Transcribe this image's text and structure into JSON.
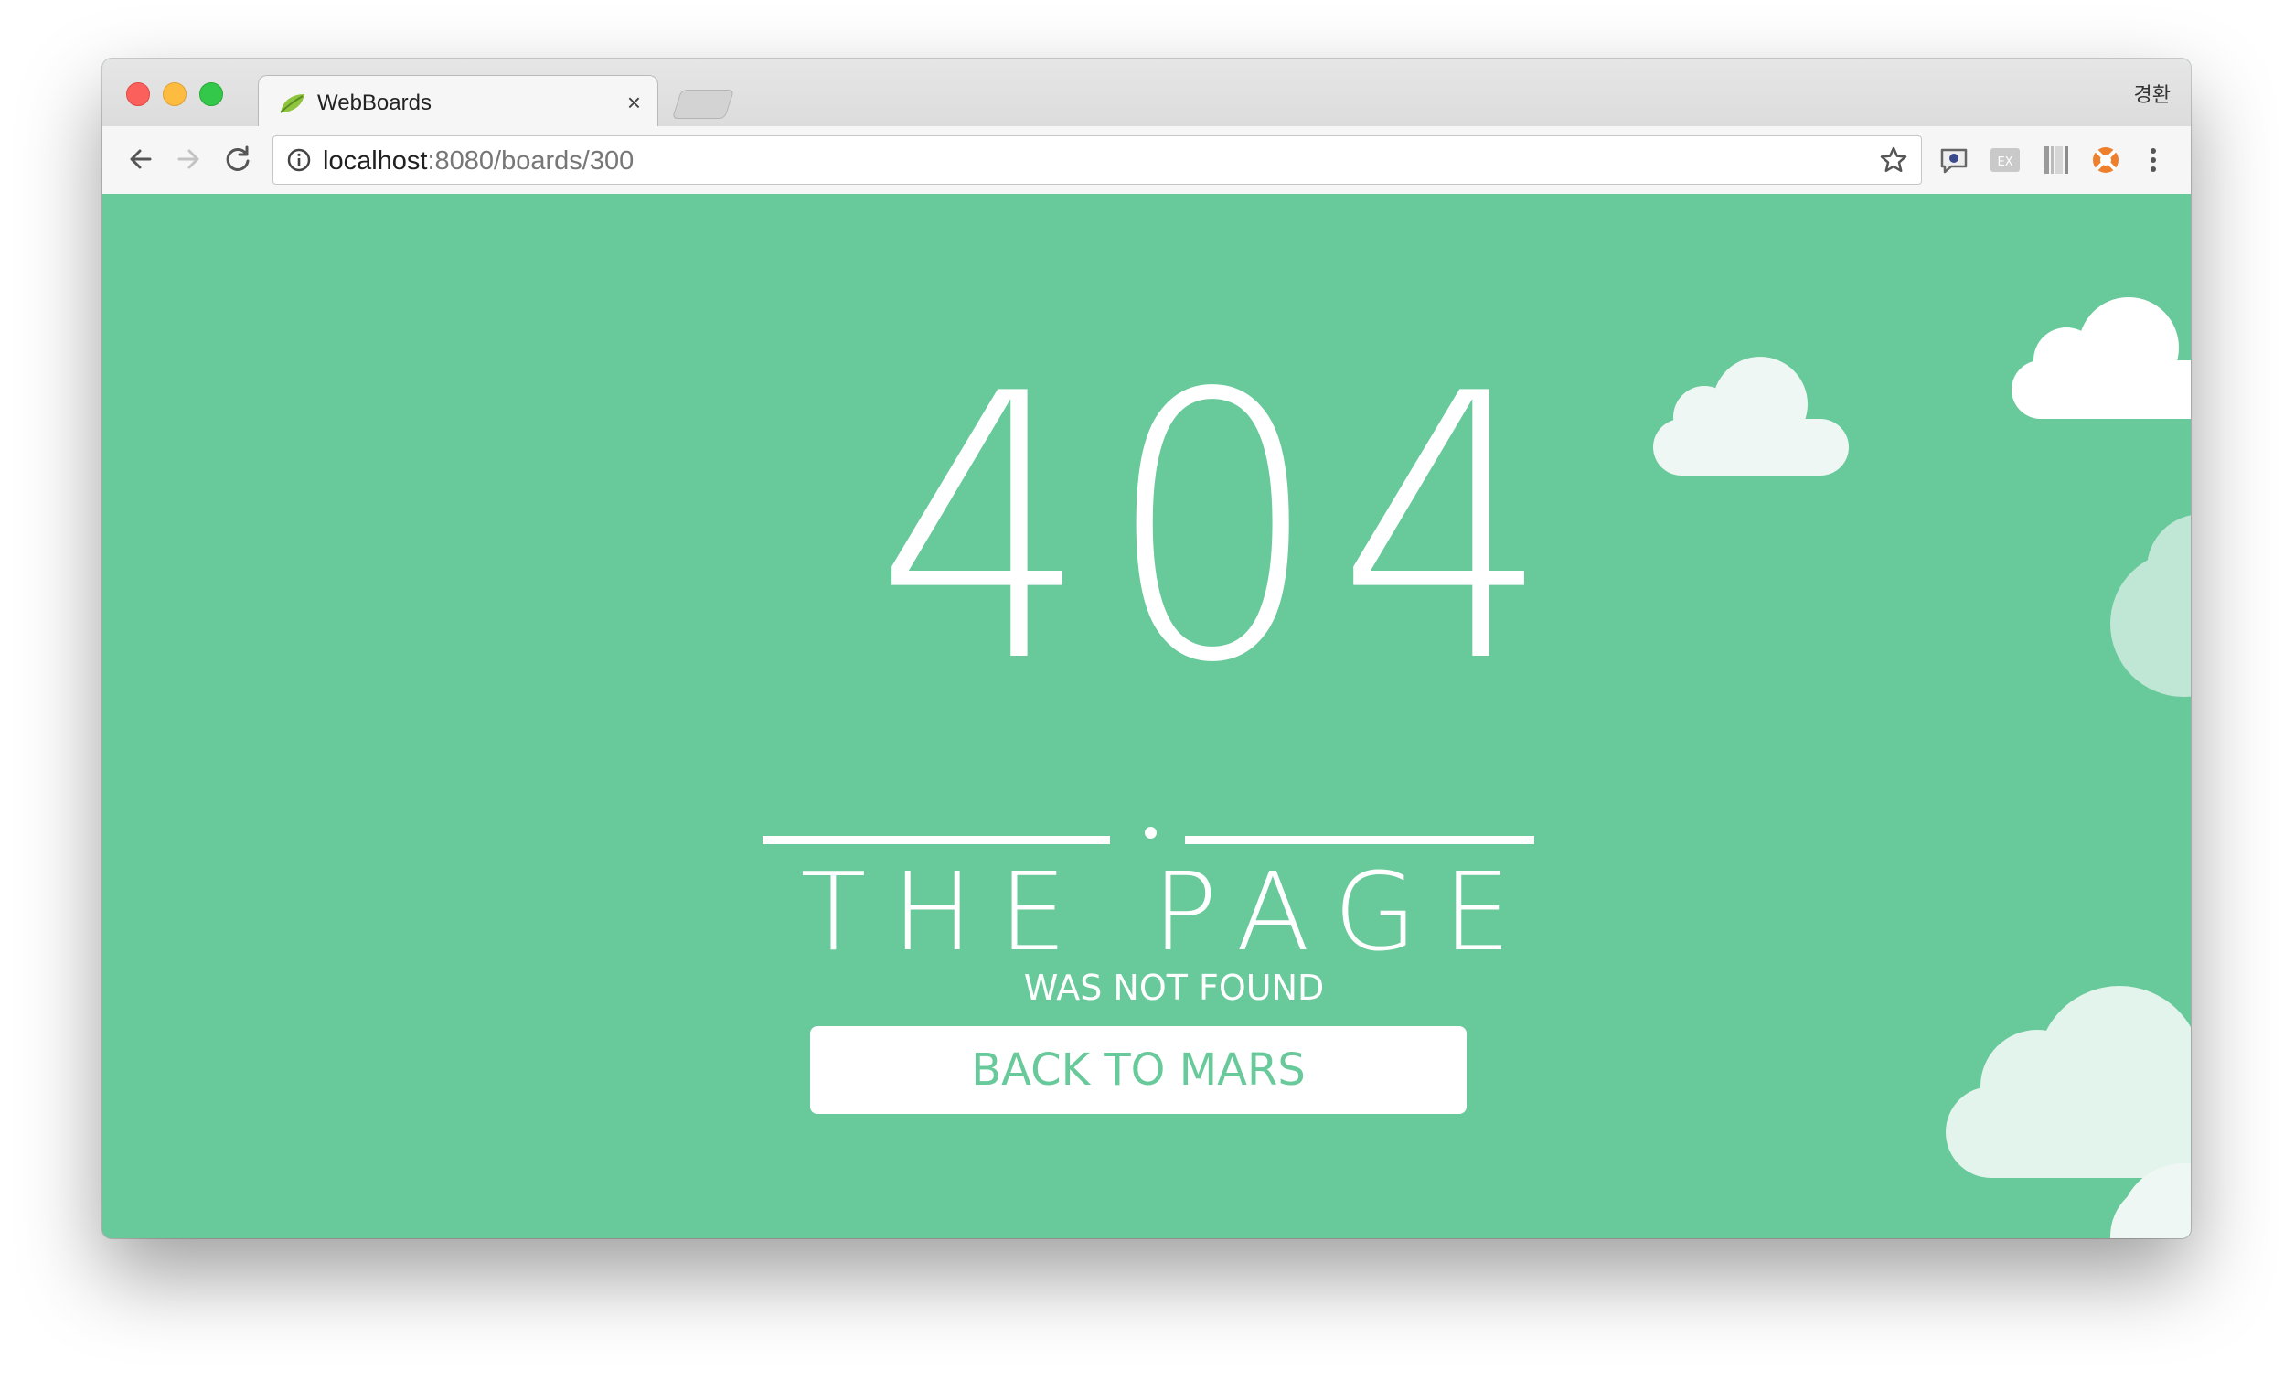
{
  "browser": {
    "tab_title": "WebBoards",
    "tab_close": "×",
    "profile_name": "경환",
    "url_host": "localhost",
    "url_rest": ":8080/boards/300"
  },
  "page": {
    "code": "404",
    "headline": "THE PAGE",
    "subline": "WAS NOT FOUND",
    "button_label": "BACK TO MARS"
  },
  "colors": {
    "background": "#68c99a",
    "text": "#ffffff"
  }
}
